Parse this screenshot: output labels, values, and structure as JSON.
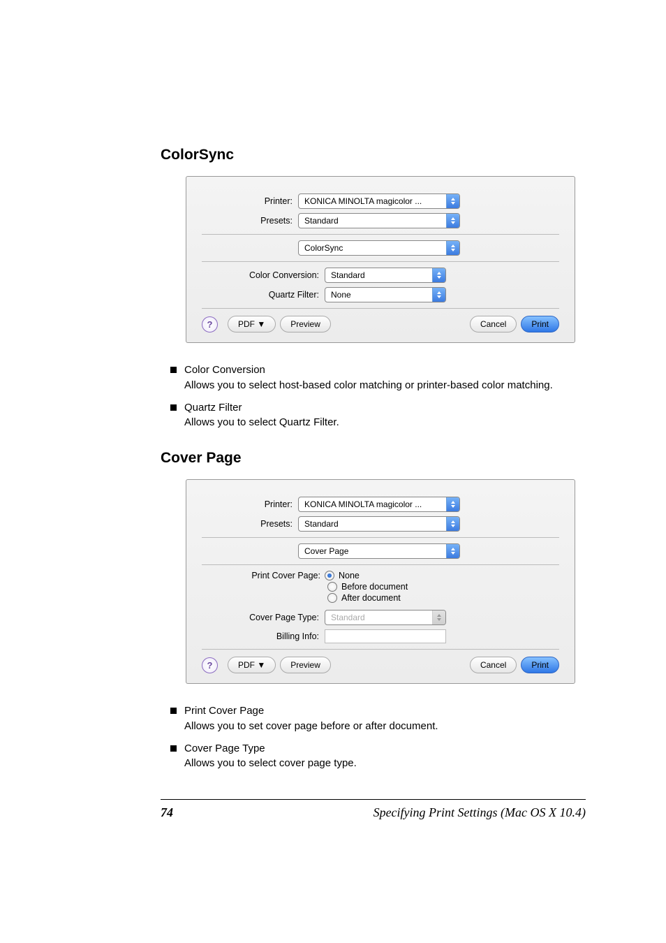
{
  "section1": {
    "heading": "ColorSync",
    "dialog": {
      "printer_label": "Printer:",
      "printer_value": "KONICA MINOLTA magicolor ...",
      "presets_label": "Presets:",
      "presets_value": "Standard",
      "pane_value": "ColorSync",
      "colorconv_label": "Color Conversion:",
      "colorconv_value": "Standard",
      "quartz_label": "Quartz Filter:",
      "quartz_value": "None",
      "help": "?",
      "pdf": "PDF ▼",
      "preview": "Preview",
      "cancel": "Cancel",
      "print": "Print"
    },
    "items": [
      {
        "title": "Color Conversion",
        "desc": "Allows you to select host-based color matching or printer-based color matching."
      },
      {
        "title": "Quartz Filter",
        "desc": "Allows you to select Quartz Filter."
      }
    ]
  },
  "section2": {
    "heading": "Cover Page",
    "dialog": {
      "printer_label": "Printer:",
      "printer_value": "KONICA MINOLTA magicolor ...",
      "presets_label": "Presets:",
      "presets_value": "Standard",
      "pane_value": "Cover Page",
      "printcover_label": "Print Cover Page:",
      "radio_none": "None",
      "radio_before": "Before document",
      "radio_after": "After document",
      "covertype_label": "Cover Page Type:",
      "covertype_value": "Standard",
      "billing_label": "Billing Info:",
      "help": "?",
      "pdf": "PDF ▼",
      "preview": "Preview",
      "cancel": "Cancel",
      "print": "Print"
    },
    "items": [
      {
        "title": "Print Cover Page",
        "desc": "Allows you to set cover page before or after document."
      },
      {
        "title": "Cover Page Type",
        "desc": "Allows you to select cover page type."
      }
    ]
  },
  "footer": {
    "pageno": "74",
    "title": "Specifying Print Settings (Mac OS X 10.4)"
  }
}
